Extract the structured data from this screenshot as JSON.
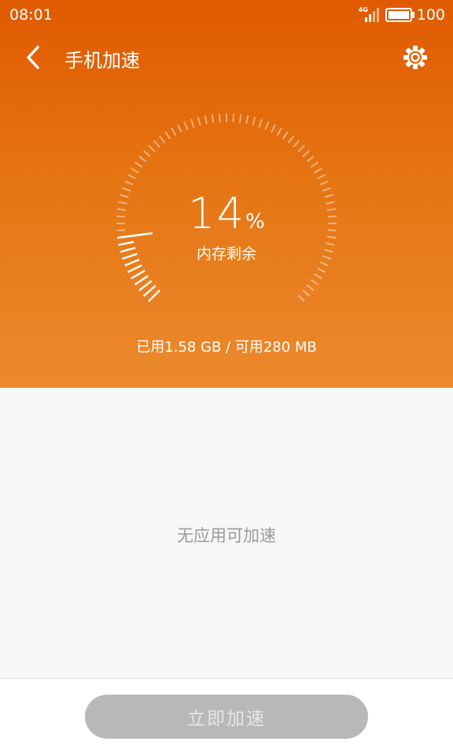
{
  "status_bar": {
    "time": "08:01",
    "network": "4G",
    "battery": "100"
  },
  "header": {
    "title": "手机加速"
  },
  "gauge": {
    "percent": "14",
    "unit": "%",
    "label": "内存剩余",
    "percent_value": 14
  },
  "usage": "已用1.58 GB / 可用280 MB",
  "empty_message": "无应用可加速",
  "action_button": "立即加速",
  "colors": {
    "top_gradient_start": "#e05a00",
    "top_gradient_end": "#ec8a2e",
    "button_disabled": "#b8b8b8"
  }
}
